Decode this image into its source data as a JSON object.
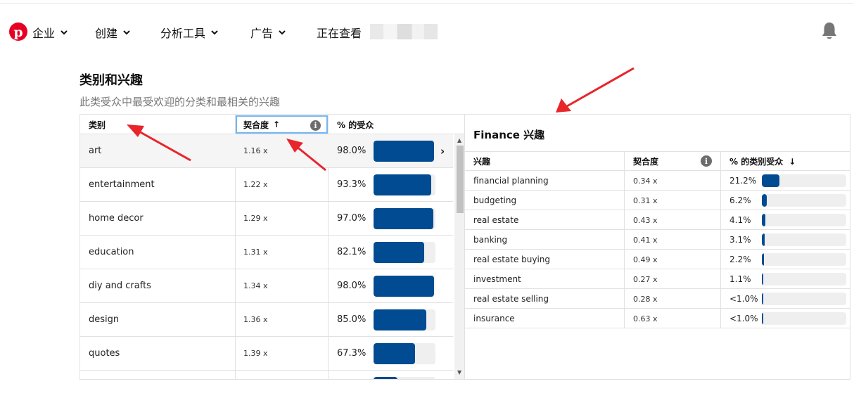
{
  "nav": {
    "items": [
      {
        "label": "企业",
        "has_dropdown": true
      },
      {
        "label": "创建",
        "has_dropdown": true
      },
      {
        "label": "分析工具",
        "has_dropdown": true
      },
      {
        "label": "广告",
        "has_dropdown": true
      },
      {
        "label": "正在查看",
        "has_dropdown": false
      }
    ],
    "logo_icon": "pinterest-logo-icon",
    "bell_icon": "bell-icon"
  },
  "section": {
    "title": "类别和兴趣",
    "subtitle": "此类受众中最受欢迎的分类和最相关的兴趣"
  },
  "categories_table": {
    "headers": {
      "category": "类别",
      "affinity": "契合度",
      "affinity_sort": "↑",
      "audience": "% 的受众"
    },
    "rows": [
      {
        "category": "art",
        "affinity": "1.16 x",
        "audience": "98.0%",
        "audience_fraction": 0.98
      },
      {
        "category": "entertainment",
        "affinity": "1.22 x",
        "audience": "93.3%",
        "audience_fraction": 0.933
      },
      {
        "category": "home decor",
        "affinity": "1.29 x",
        "audience": "97.0%",
        "audience_fraction": 0.97
      },
      {
        "category": "education",
        "affinity": "1.31 x",
        "audience": "82.1%",
        "audience_fraction": 0.821
      },
      {
        "category": "diy and crafts",
        "affinity": "1.34 x",
        "audience": "98.0%",
        "audience_fraction": 0.98
      },
      {
        "category": "design",
        "affinity": "1.36 x",
        "audience": "85.0%",
        "audience_fraction": 0.85
      },
      {
        "category": "quotes",
        "affinity": "1.39 x",
        "audience": "67.3%",
        "audience_fraction": 0.673
      }
    ]
  },
  "interests_panel": {
    "title": "Finance 兴趣",
    "headers": {
      "interest": "兴趣",
      "affinity": "契合度",
      "pct": "% 的类别受众",
      "pct_sort": "↓"
    },
    "rows": [
      {
        "interest": "financial planning",
        "affinity": "0.34 x",
        "pct": "21.2%",
        "fraction": 0.212
      },
      {
        "interest": "budgeting",
        "affinity": "0.31 x",
        "pct": "6.2%",
        "fraction": 0.062
      },
      {
        "interest": "real estate",
        "affinity": "0.43 x",
        "pct": "4.1%",
        "fraction": 0.041
      },
      {
        "interest": "banking",
        "affinity": "0.41 x",
        "pct": "3.1%",
        "fraction": 0.031
      },
      {
        "interest": "real estate buying",
        "affinity": "0.49 x",
        "pct": "2.2%",
        "fraction": 0.022
      },
      {
        "interest": "investment",
        "affinity": "0.27 x",
        "pct": "1.1%",
        "fraction": 0.011
      },
      {
        "interest": "real estate selling",
        "affinity": "0.28 x",
        "pct": "<1.0%",
        "fraction": 0.005
      },
      {
        "interest": "insurance",
        "affinity": "0.63 x",
        "pct": "<1.0%",
        "fraction": 0.005
      }
    ]
  },
  "colors": {
    "brand": "#e60023",
    "bar_fill": "#004b91",
    "bar_track": "#efefef",
    "annotation": "#e8252a",
    "focus": "#73b7f3"
  }
}
